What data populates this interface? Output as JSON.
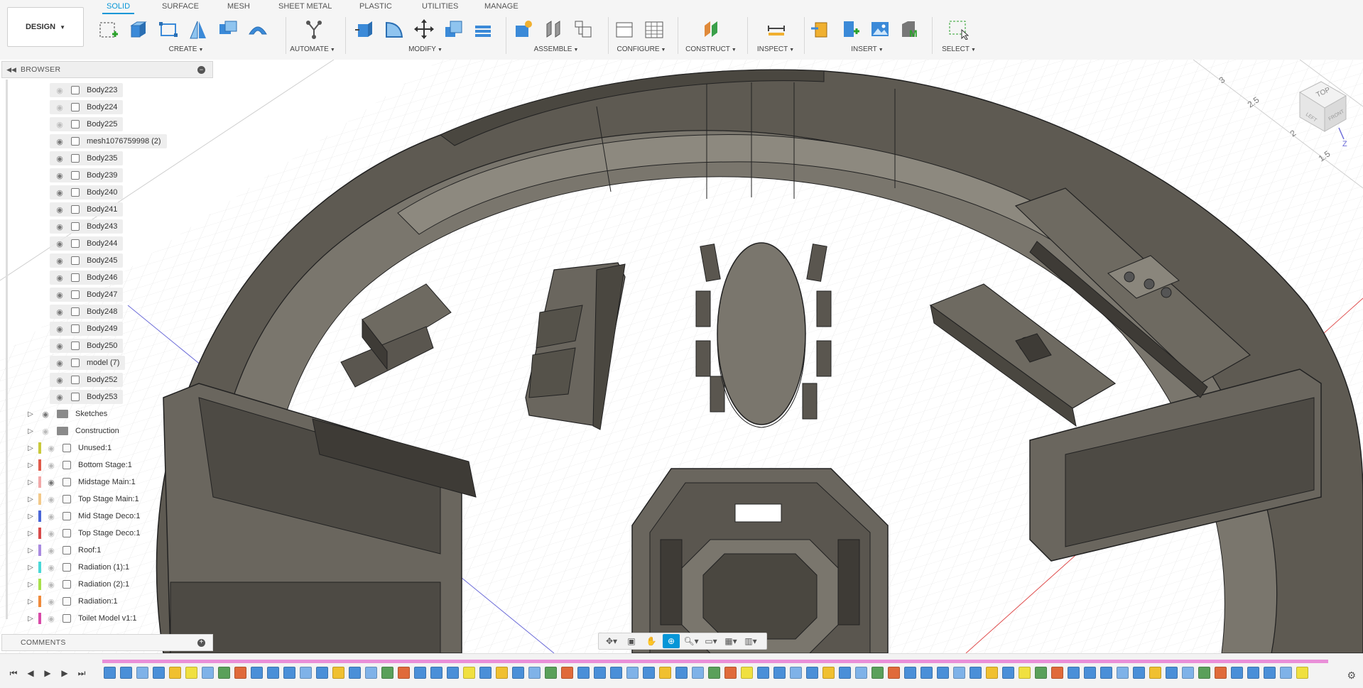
{
  "toolbar": {
    "workspace": "DESIGN",
    "tabs": [
      {
        "label": "SOLID",
        "active": true
      },
      {
        "label": "SURFACE",
        "active": false
      },
      {
        "label": "MESH",
        "active": false
      },
      {
        "label": "SHEET METAL",
        "active": false
      },
      {
        "label": "PLASTIC",
        "active": false
      },
      {
        "label": "UTILITIES",
        "active": false
      },
      {
        "label": "MANAGE",
        "active": false
      }
    ],
    "groups": {
      "create": "CREATE",
      "automate": "AUTOMATE",
      "modify": "MODIFY",
      "assemble": "ASSEMBLE",
      "configure": "CONFIGURE",
      "construct": "CONSTRUCT",
      "inspect": "INSPECT",
      "insert": "INSERT",
      "select": "SELECT"
    },
    "accent": "#0696d7"
  },
  "browser": {
    "title": "BROWSER",
    "items": [
      {
        "label": "Body223",
        "visible": false
      },
      {
        "label": "Body224",
        "visible": false
      },
      {
        "label": "Body225",
        "visible": false
      },
      {
        "label": "mesh1076759998 (2)",
        "visible": true
      },
      {
        "label": "Body235",
        "visible": true
      },
      {
        "label": "Body239",
        "visible": true
      },
      {
        "label": "Body240",
        "visible": true
      },
      {
        "label": "Body241",
        "visible": true
      },
      {
        "label": "Body243",
        "visible": true
      },
      {
        "label": "Body244",
        "visible": true
      },
      {
        "label": "Body245",
        "visible": true
      },
      {
        "label": "Body246",
        "visible": true
      },
      {
        "label": "Body247",
        "visible": true
      },
      {
        "label": "Body248",
        "visible": true
      },
      {
        "label": "Body249",
        "visible": true
      },
      {
        "label": "Body250",
        "visible": true
      },
      {
        "label": "model (7)",
        "visible": true
      },
      {
        "label": "Body252",
        "visible": true
      },
      {
        "label": "Body253",
        "visible": true
      }
    ],
    "folders": [
      {
        "label": "Sketches",
        "visible": true
      },
      {
        "label": "Construction",
        "visible": false
      }
    ],
    "components": [
      {
        "label": "Unused:1",
        "color": "#c9c93a",
        "visible": false
      },
      {
        "label": "Bottom Stage:1",
        "color": "#e05a4a",
        "visible": false
      },
      {
        "label": "Midstage Main:1",
        "color": "#f2a8a8",
        "visible": true
      },
      {
        "label": "Top Stage Main:1",
        "color": "#f3c98a",
        "visible": false
      },
      {
        "label": "Mid Stage Deco:1",
        "color": "#4a66d8",
        "visible": false
      },
      {
        "label": "Top Stage Deco:1",
        "color": "#d84a4a",
        "visible": false
      },
      {
        "label": "Roof:1",
        "color": "#a98ae0",
        "visible": false
      },
      {
        "label": "Radiation (1):1",
        "color": "#4ad8d8",
        "visible": false
      },
      {
        "label": "Radiation (2):1",
        "color": "#a8e04a",
        "visible": false
      },
      {
        "label": "Radiation:1",
        "color": "#f08a3a",
        "visible": false
      },
      {
        "label": "Toilet Model v1:1",
        "color": "#d84aa8",
        "visible": false
      }
    ]
  },
  "comments": {
    "title": "COMMENTS"
  },
  "viewcube": {
    "face": "TOP",
    "left": "LEFT",
    "front": "FRONT",
    "axis": "Z"
  },
  "grid_labels": [
    "3",
    "2.5",
    "2",
    "1.5"
  ],
  "timeline": {
    "stripe_color": "#e98fd8"
  }
}
